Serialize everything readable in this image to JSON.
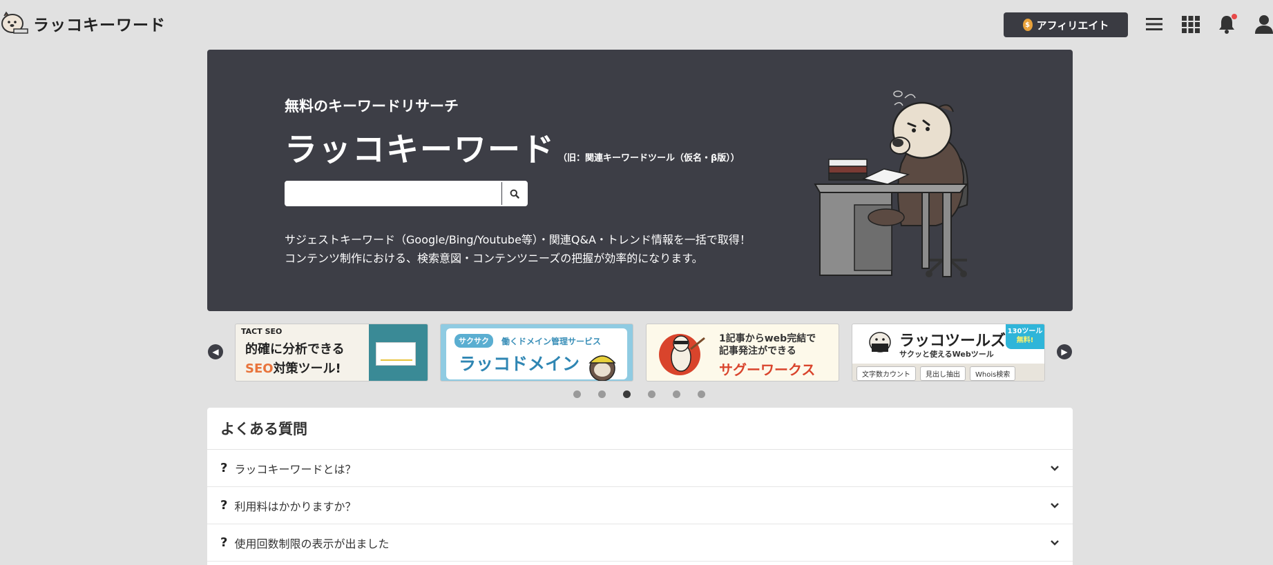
{
  "header": {
    "logo_text": "ラッコキーワード",
    "affiliate_label": "アフィリエイト",
    "coin_symbol": "$",
    "notification_badge_color": "#e84a4a"
  },
  "hero": {
    "subtitle": "無料のキーワードリサーチ",
    "title": "ラッコキーワード",
    "title_note": "（旧：関連キーワードツール（仮名・β版））",
    "search_placeholder": "",
    "search_value": "",
    "desc_line1": "サジェストキーワード（Google/Bing/Youtube等）・関連Q&A・トレンド情報を一括で取得！",
    "desc_line2": "コンテンツ制作における、検索意図・コンテンツニーズの把握が効率的になります。",
    "background_color": "#3d3e46"
  },
  "carousel": {
    "prev_icon": "chevron-left-icon",
    "next_icon": "chevron-right-icon",
    "banners": [
      {
        "brand": "TACT SEO",
        "line1": "的確に分析できる",
        "line2_accent": "SEO",
        "line2": "対策ツール!"
      },
      {
        "tag": "サクサク",
        "tagline": "働くドメイン管理サービス",
        "name": "ラッコドメイン"
      },
      {
        "line1": "1記事からweb完結で",
        "line2": "記事発注ができる",
        "name": "サグーワークス"
      },
      {
        "name": "ラッコツールズ",
        "tagline": "サクッと使えるWebツール",
        "badge_line1": "130ツール",
        "badge_line2": "無料!",
        "chips": [
          "文字数カウント",
          "見出し抽出",
          "Whois検索"
        ]
      }
    ],
    "dot_count": 6,
    "active_dot": 3
  },
  "faq": {
    "title": "よくある質問",
    "q_mark": "?",
    "items": [
      {
        "question": "ラッコキーワードとは？"
      },
      {
        "question": "利用料はかかりますか？"
      },
      {
        "question": "使用回数制限の表示が出ました"
      }
    ]
  }
}
